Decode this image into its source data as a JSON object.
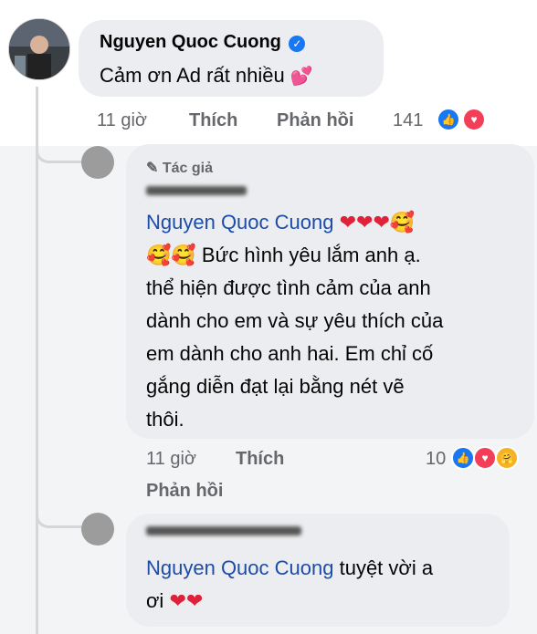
{
  "comment1": {
    "author": "Nguyen Quoc Cuong",
    "text": "Cảm ơn Ad rất nhiều",
    "emoji": "💕",
    "time": "11 giờ",
    "like_label": "Thích",
    "reply_label": "Phản hồi",
    "reaction_count": "141"
  },
  "reply1": {
    "author_badge": "Tác giả",
    "mention": "Nguyen Quoc Cuong",
    "text_line1_emoji": "❤❤❤🥰",
    "text_line2_emoji": "🥰🥰",
    "line2": "Bức hình yêu lắm anh ạ.",
    "line3": "thể hiện được tình cảm của anh",
    "line4": "dành cho em và sự yêu thích của",
    "line5": "em dành cho anh hai. Em chỉ cố",
    "line6": "gắng diễn đạt lại bằng nét vẽ",
    "line7": "thôi.",
    "time": "11 giờ",
    "like_label": "Thích",
    "reply_label": "Phản hồi",
    "reaction_count": "10"
  },
  "reply2": {
    "mention": "Nguyen Quoc Cuong",
    "text": "tuyệt vời a",
    "line2": "ơi",
    "emoji": "❤❤"
  },
  "colors": {
    "link": "#1d4ca8",
    "bubble": "#ebedf0",
    "like_blue": "#1877f2",
    "love_red": "#f33e58",
    "meta_gray": "#65676b"
  },
  "icons": [
    "verified-badge-icon",
    "pencil-icon",
    "like-reaction-icon",
    "love-reaction-icon",
    "care-reaction-icon"
  ]
}
